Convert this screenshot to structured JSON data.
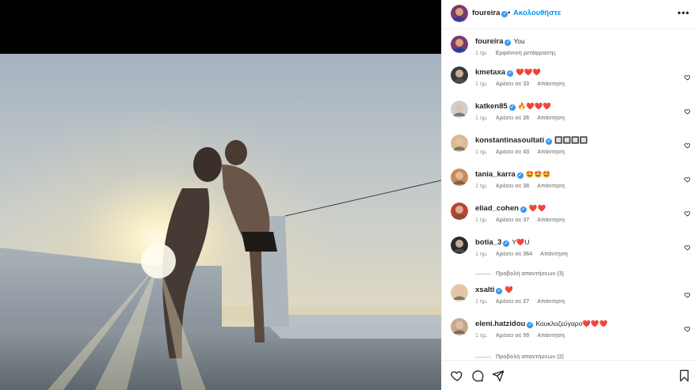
{
  "post": {
    "author": "foureira",
    "follow_label": "Ακολουθήστε",
    "dot": "•",
    "more_label": "•••"
  },
  "caption": {
    "user": "foureira",
    "text": "You",
    "time": "1 ημ.",
    "translate": "Εμφάνιση μετάφρασης"
  },
  "comments": [
    {
      "user": "kmetaxa",
      "text": "❤️❤️❤️",
      "time": "1 ημ.",
      "likes": "Αρέσει σε 33",
      "reply": "Απάντηση",
      "avatar_color": "#3a3a3a"
    },
    {
      "user": "katken85",
      "text": "🔥❤️❤️❤️",
      "time": "1 ημ.",
      "likes": "Αρέσει σε 26",
      "reply": "Απάντηση",
      "avatar_color": "#cfcfcf"
    },
    {
      "user": "konstantinasoultati",
      "text": "🔲🔲🔲🔲",
      "time": "1 ημ.",
      "likes": "Αρέσει σε 43",
      "reply": "Απάντηση",
      "avatar_color": "#d9b98f"
    },
    {
      "user": "tania_karra",
      "text": "🤩🤩🤩",
      "time": "1 ημ.",
      "likes": "Αρέσει σε 38",
      "reply": "Απάντηση",
      "avatar_color": "#c98a58"
    },
    {
      "user": "eliad_cohen",
      "text": "❤️❤️",
      "time": "1 ημ.",
      "likes": "Αρέσει σε 37",
      "reply": "Απάντηση",
      "avatar_color": "#b5472f"
    },
    {
      "user": "botia_3",
      "text": "Y❤️U",
      "time": "1 ημ.",
      "likes": "Αρέσει σε 364",
      "reply": "Απάντηση",
      "avatar_color": "#2b2b2b"
    },
    {
      "user": "xsalti",
      "text": "❤️",
      "time": "1 ημ.",
      "likes": "Αρέσει σε 27",
      "reply": "Απάντηση",
      "avatar_color": "#e0c9a6"
    },
    {
      "user": "eleni.hatzidou",
      "text": "Κουκλοζεύγαρο❤️❤️❤️",
      "time": "1 ημ.",
      "likes": "Αρέσει σε 59",
      "reply": "Απάντηση",
      "avatar_color": "#c4a98c"
    }
  ],
  "view_replies": "Προβολή απαντήσεων (3)",
  "view_replies_2": "Προβολή απαντήσεων (2)",
  "icons": {
    "like": "heart-icon",
    "comment": "comment-icon",
    "share": "paper-plane-icon",
    "save": "bookmark-icon"
  }
}
